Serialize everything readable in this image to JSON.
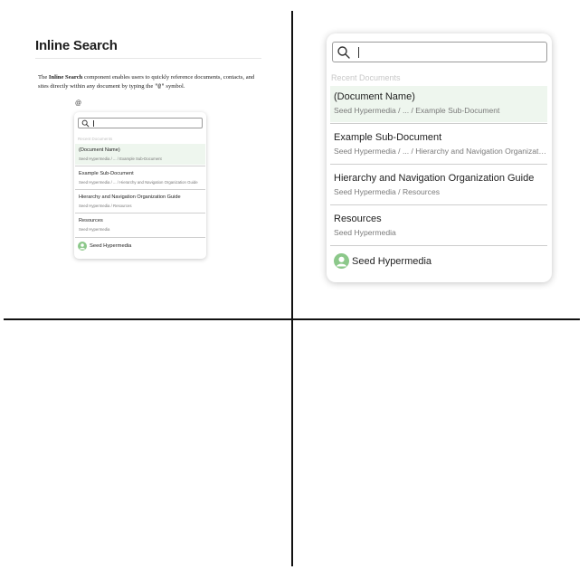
{
  "documentation": {
    "title": "Inline Search",
    "paragraph": {
      "prefix": "The ",
      "component_name": "Inline Search",
      "middle": " component enables users to quickly reference documents, contacts, and sites directly within any document by typing the ",
      "trigger_code": "\"@\"",
      "suffix": " symbol."
    },
    "trigger_char": "@"
  },
  "inline_search": {
    "search": {
      "value": "",
      "placeholder": ""
    },
    "section_label": "Recent Documents",
    "items": [
      {
        "name": "(Document Name)",
        "path": "Seed Hypermedia  /  ...  /  Example Sub-Document",
        "active": true
      },
      {
        "name": "Example Sub-Document",
        "path": "Seed Hypermedia  /  ...  /  Hierarchy and Navigation Organization Guide",
        "active": false
      },
      {
        "name": "Hierarchy and Navigation Organization Guide",
        "path": "Seed Hypermedia  /  Resources",
        "active": false
      },
      {
        "name": "Resources",
        "path": "Seed Hypermedia",
        "active": false
      }
    ],
    "site": {
      "label": "Seed Hypermedia",
      "icon": "avatar-icon"
    }
  },
  "colors": {
    "active_item_bg": "#eef6ee",
    "avatar_green": "#8cc88a",
    "divider": "#111111"
  }
}
